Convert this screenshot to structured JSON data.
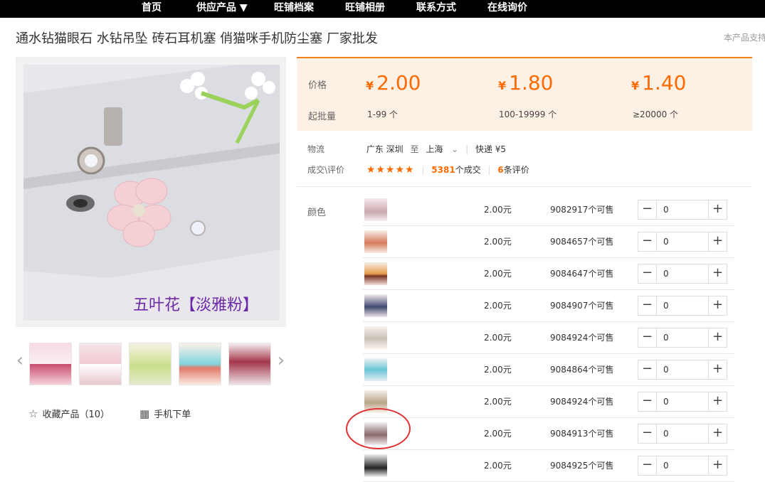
{
  "nav": {
    "items": [
      "首页",
      "供应产品 ▼",
      "旺铺档案",
      "旺铺相册",
      "联系方式",
      "在线询价"
    ]
  },
  "product": {
    "title": "通水钻猫眼石 水钻吊坠 砖石耳机塞 俏猫咪手机防尘塞 厂家批发",
    "support_text": "本产品支持",
    "image_caption": "五叶花【淡雅粉】"
  },
  "gallery": {
    "favorite_label": "收藏产品（10）",
    "mobile_label": "手机下单",
    "prev_icon": "chevron-left-icon",
    "next_icon": "chevron-right-icon"
  },
  "pricing": {
    "price_label": "价格",
    "moq_label": "起批量",
    "currency": "¥",
    "tiers": [
      {
        "price": "2.00",
        "qty": "1-99 个"
      },
      {
        "price": "1.80",
        "qty": "100-19999 个"
      },
      {
        "price": "1.40",
        "qty": "≥20000 个"
      }
    ]
  },
  "logistics": {
    "label": "物流",
    "from": "广东 深圳",
    "to_word": "至",
    "to": "上海",
    "method": "快递 ¥5"
  },
  "deals": {
    "label": "成交\\评价",
    "stars": "★★★★★",
    "count": "5381",
    "count_suffix": "个成交",
    "reviews": "6",
    "reviews_suffix": "条评价"
  },
  "sku": {
    "color_label": "颜色",
    "rows": [
      {
        "price": "2.00元",
        "stock": "9082917个可售",
        "qty": "0"
      },
      {
        "price": "2.00元",
        "stock": "9084657个可售",
        "qty": "0"
      },
      {
        "price": "2.00元",
        "stock": "9084647个可售",
        "qty": "0"
      },
      {
        "price": "2.00元",
        "stock": "9084907个可售",
        "qty": "0"
      },
      {
        "price": "2.00元",
        "stock": "9084924个可售",
        "qty": "0"
      },
      {
        "price": "2.00元",
        "stock": "9084864个可售",
        "qty": "0"
      },
      {
        "price": "2.00元",
        "stock": "9084924个可售",
        "qty": "0"
      },
      {
        "price": "2.00元",
        "stock": "9084913个可售",
        "qty": "0"
      },
      {
        "price": "2.00元",
        "stock": "9084925个可售",
        "qty": "0"
      }
    ]
  },
  "colors": {
    "accent": "#ff6a00",
    "highlight_circle": "#e03030",
    "price_bg": "#fdf1e6"
  }
}
